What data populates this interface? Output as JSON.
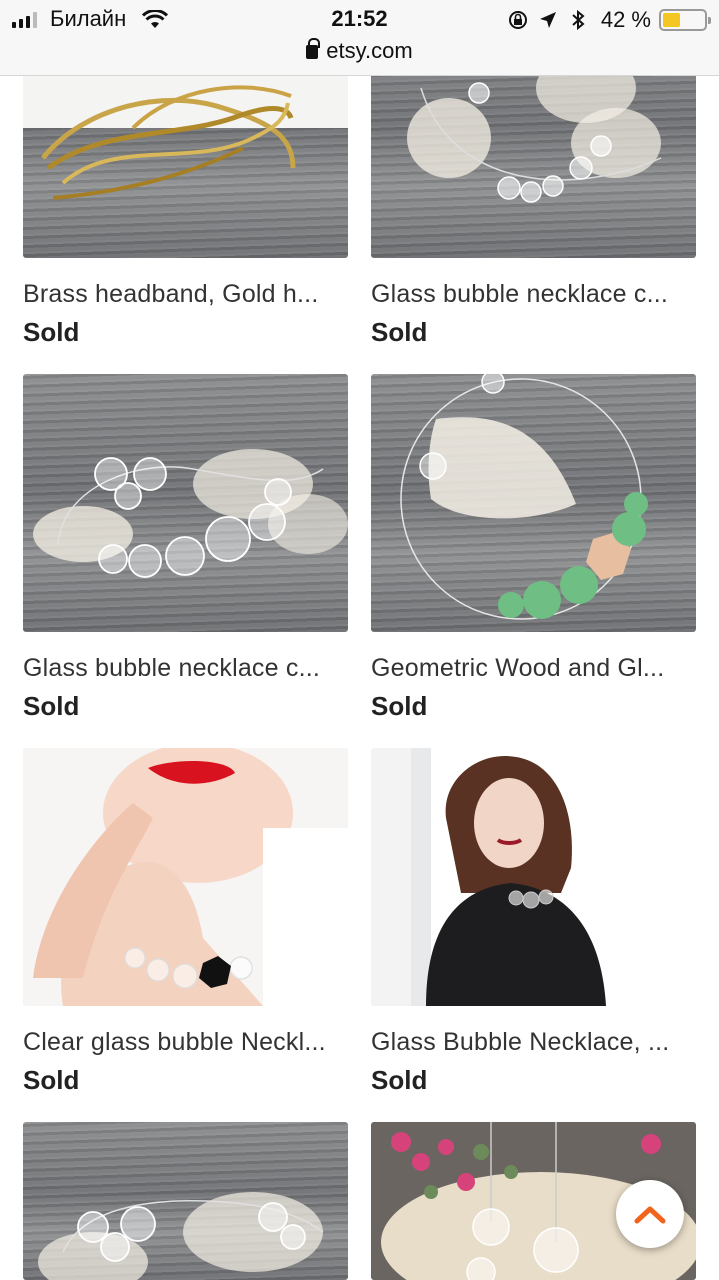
{
  "status": {
    "carrier": "Билайн",
    "time": "21:52",
    "battery": "42 %",
    "battery_level": 0.42
  },
  "browser": {
    "url": "etsy.com"
  },
  "listings": [
    {
      "title": "Brass headband, Gold h...",
      "price": "Sold",
      "image": "brass-headband"
    },
    {
      "title": "Glass bubble necklace c...",
      "price": "Sold",
      "image": "glass-bubble-leaves"
    },
    {
      "title": "Glass bubble necklace c...",
      "price": "Sold",
      "image": "glass-bubble-leaves"
    },
    {
      "title": "Geometric Wood and Gl...",
      "price": "Sold",
      "image": "geometric-wood-green"
    },
    {
      "title": "Clear glass bubble Neckl...",
      "price": "Sold",
      "image": "model-red-lips"
    },
    {
      "title": "Glass Bubble Necklace, ...",
      "price": "Sold",
      "image": "model-black-dress"
    },
    {
      "title": "",
      "price": "",
      "image": "glass-bubble-leaves"
    },
    {
      "title": "",
      "price": "",
      "image": "dried-flowers-bubbles"
    }
  ],
  "icons": {
    "favorite": "heart-icon",
    "scroll_top": "chevron-up-icon"
  },
  "colors": {
    "accent": "#f1641e",
    "battery": "#f3c623"
  }
}
